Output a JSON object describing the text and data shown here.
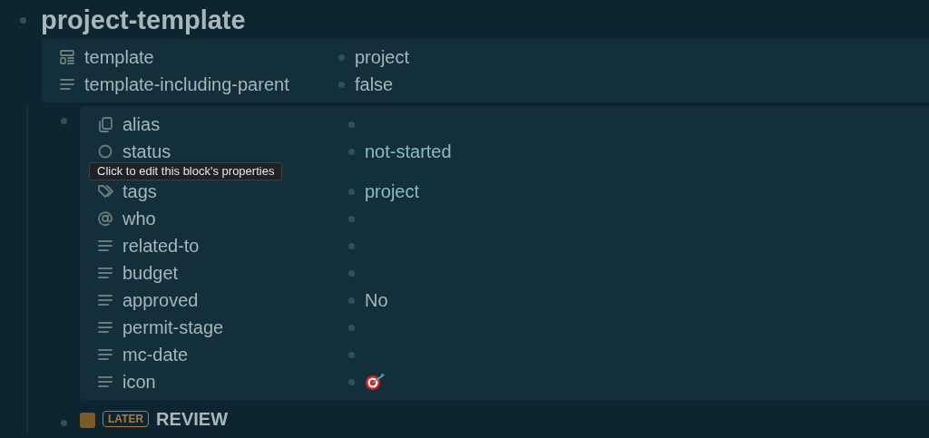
{
  "page": {
    "title": "project-template",
    "properties": [
      {
        "kind": "template",
        "key": "template",
        "value": {
          "kind": "plain",
          "text": "project"
        }
      },
      {
        "kind": "text",
        "key": "template-including-parent",
        "value": {
          "kind": "plain",
          "text": "false"
        }
      }
    ]
  },
  "blocks": [
    {
      "tooltip": "Click to edit this block's properties",
      "properties": [
        {
          "kind": "alias",
          "key": "alias"
        },
        {
          "kind": "status",
          "key": "status",
          "value": {
            "kind": "ref",
            "text": "not-started"
          }
        },
        {
          "kind": "tags",
          "key": "tags",
          "value": {
            "kind": "ref",
            "text": "project"
          }
        },
        {
          "kind": "who",
          "key": "who"
        },
        {
          "kind": "text",
          "key": "related-to"
        },
        {
          "kind": "text",
          "key": "budget"
        },
        {
          "kind": "text",
          "key": "approved",
          "value": {
            "kind": "plain",
            "text": "No"
          }
        },
        {
          "kind": "text",
          "key": "permit-stage"
        },
        {
          "kind": "text",
          "key": "mc-date"
        },
        {
          "kind": "text",
          "key": "icon",
          "value": {
            "kind": "target"
          }
        }
      ]
    },
    {
      "marker": "LATER",
      "text": "REVIEW",
      "checked": false
    }
  ]
}
